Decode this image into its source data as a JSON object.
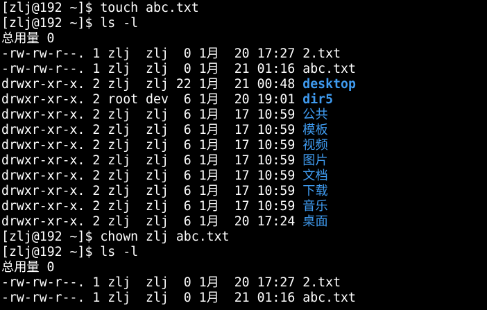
{
  "colors": {
    "background": "#000000",
    "text": "#ffffff",
    "directory": "#3f9bf0"
  },
  "terminal": {
    "lines": [
      {
        "kind": "prompt",
        "prompt": "[zlj@192 ~]$ ",
        "command": "touch abc.txt"
      },
      {
        "kind": "prompt",
        "prompt": "[zlj@192 ~]$ ",
        "command": "ls -l"
      },
      {
        "kind": "text",
        "text": "总用量 0"
      },
      {
        "kind": "entry",
        "meta": "-rw-rw-r--. 1 zlj  zlj  0 1月  20 17:27 ",
        "name": "2.txt",
        "is_dir": false
      },
      {
        "kind": "entry",
        "meta": "-rw-rw-r--. 1 zlj  zlj  0 1月  21 01:16 ",
        "name": "abc.txt",
        "is_dir": false
      },
      {
        "kind": "entry",
        "meta": "drwxr-xr-x. 2 zlj  zlj 22 1月  21 00:48 ",
        "name": "desktop",
        "is_dir": true
      },
      {
        "kind": "entry",
        "meta": "drwxr-xr-x. 2 root dev  6 1月  20 19:01 ",
        "name": "dir5",
        "is_dir": true
      },
      {
        "kind": "entry",
        "meta": "drwxr-xr-x. 2 zlj  zlj  6 1月  17 10:59 ",
        "name": "公共",
        "is_dir": true
      },
      {
        "kind": "entry",
        "meta": "drwxr-xr-x. 2 zlj  zlj  6 1月  17 10:59 ",
        "name": "模板",
        "is_dir": true
      },
      {
        "kind": "entry",
        "meta": "drwxr-xr-x. 2 zlj  zlj  6 1月  17 10:59 ",
        "name": "视频",
        "is_dir": true
      },
      {
        "kind": "entry",
        "meta": "drwxr-xr-x. 2 zlj  zlj  6 1月  17 10:59 ",
        "name": "图片",
        "is_dir": true
      },
      {
        "kind": "entry",
        "meta": "drwxr-xr-x. 2 zlj  zlj  6 1月  17 10:59 ",
        "name": "文档",
        "is_dir": true
      },
      {
        "kind": "entry",
        "meta": "drwxr-xr-x. 2 zlj  zlj  6 1月  17 10:59 ",
        "name": "下载",
        "is_dir": true
      },
      {
        "kind": "entry",
        "meta": "drwxr-xr-x. 2 zlj  zlj  6 1月  17 10:59 ",
        "name": "音乐",
        "is_dir": true
      },
      {
        "kind": "entry",
        "meta": "drwxr-xr-x. 2 zlj  zlj  6 1月  20 17:24 ",
        "name": "桌面",
        "is_dir": true
      },
      {
        "kind": "prompt",
        "prompt": "[zlj@192 ~]$ ",
        "command": "chown zlj abc.txt"
      },
      {
        "kind": "prompt",
        "prompt": "[zlj@192 ~]$ ",
        "command": "ls -l"
      },
      {
        "kind": "text",
        "text": "总用量 0"
      },
      {
        "kind": "entry",
        "meta": "-rw-rw-r--. 1 zlj  zlj  0 1月  20 17:27 ",
        "name": "2.txt",
        "is_dir": false
      },
      {
        "kind": "entry",
        "meta": "-rw-rw-r--. 1 zlj  zlj  0 1月  21 01:16 ",
        "name": "abc.txt",
        "is_dir": false
      }
    ]
  }
}
